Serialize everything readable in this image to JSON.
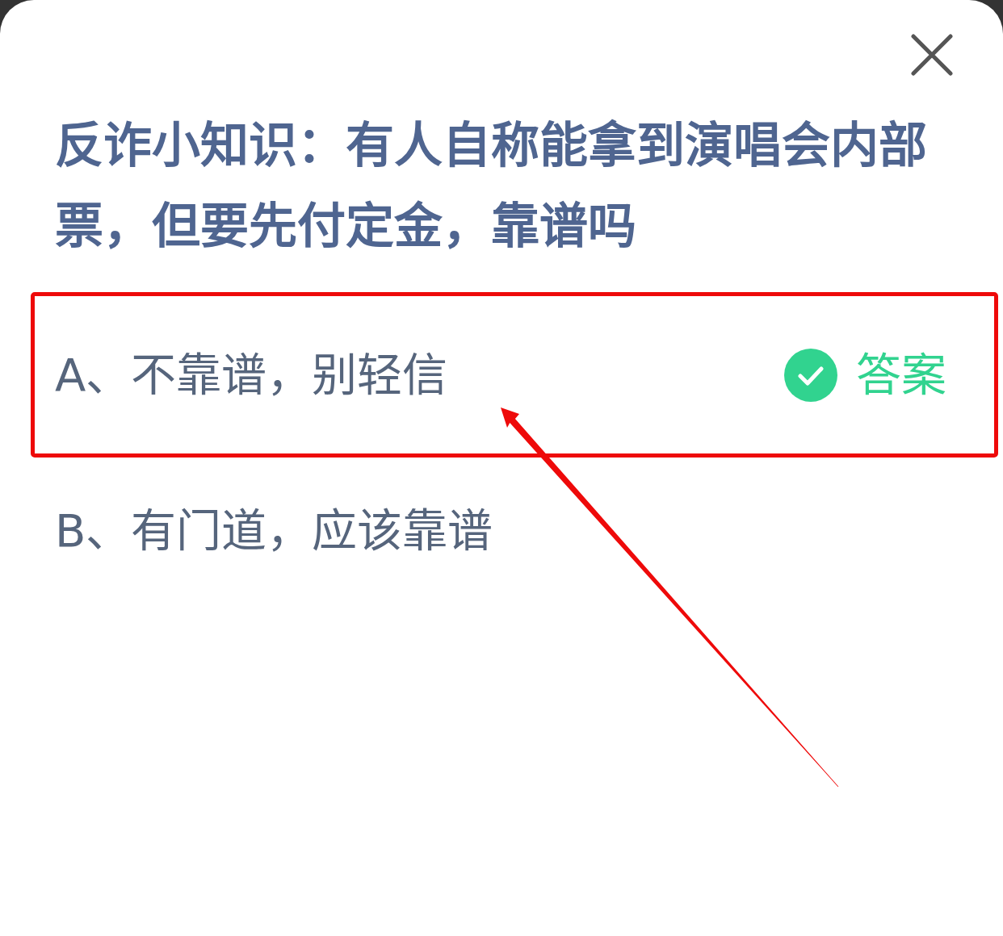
{
  "question": "反诈小知识：有人自称能拿到演唱会内部票，但要先付定金，靠谱吗",
  "options": [
    {
      "text": "A、不靠谱，别轻信",
      "correct": true,
      "badge": "答案",
      "highlighted": true
    },
    {
      "text": "B、有门道，应该靠谱",
      "correct": false,
      "highlighted": false
    }
  ]
}
